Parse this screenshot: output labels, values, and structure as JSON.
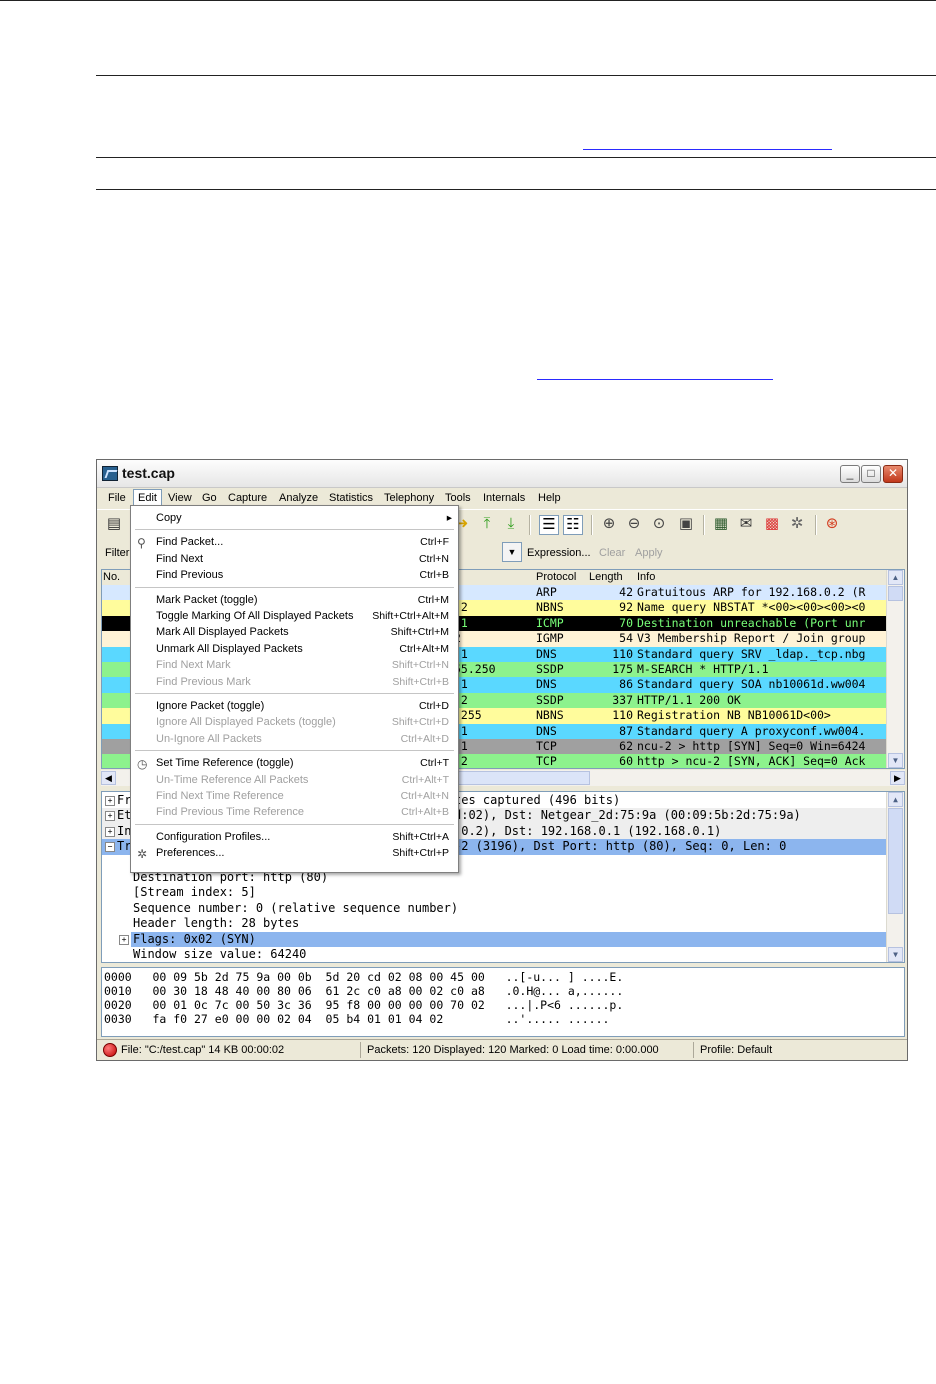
{
  "window": {
    "title": "test.cap",
    "controls": {
      "minimize": "_",
      "maximize": "□",
      "close": "✕"
    }
  },
  "menubar": [
    "File",
    "Edit",
    "View",
    "Go",
    "Capture",
    "Analyze",
    "Statistics",
    "Telephony",
    "Tools",
    "Internals",
    "Help"
  ],
  "filterbar": {
    "label": "Filter",
    "expression": "Expression...",
    "clear": "Clear",
    "apply": "Apply"
  },
  "packet_list": {
    "columns": [
      "No.",
      "Protocol",
      "Length",
      "Info"
    ],
    "rows": [
      {
        "tail": "",
        "protocol": "ARP",
        "length": "42",
        "info": "Gratuitous ARP for 192.168.0.2 (R",
        "bg": "#d6e8ff",
        "fg": "#000000"
      },
      {
        "tail": ".2",
        "protocol": "NBNS",
        "length": "92",
        "info": "Name query NBSTAT *<00><00><00><0",
        "bg": "#fffc9c",
        "fg": "#000000"
      },
      {
        "tail": ".1",
        "protocol": "ICMP",
        "length": "70",
        "info": "Destination unreachable (Port unr",
        "bg": "#000000",
        "fg": "#78ff78"
      },
      {
        "tail": "2",
        "protocol": "IGMP",
        "length": "54",
        "info": "V3 Membership Report / Join group",
        "bg": "#fff3d6",
        "fg": "#000000"
      },
      {
        "tail": ".1",
        "protocol": "DNS",
        "length": "110",
        "info": "Standard query SRV _ldap._tcp.nbg",
        "bg": "#5ad8ff",
        "fg": "#000000"
      },
      {
        "tail": "55.250",
        "protocol": "SSDP",
        "length": "175",
        "info": "M-SEARCH * HTTP/1.1",
        "bg": "#8df28d",
        "fg": "#000000"
      },
      {
        "tail": ".1",
        "protocol": "DNS",
        "length": "86",
        "info": "Standard query SOA nb10061d.ww004",
        "bg": "#5ad8ff",
        "fg": "#000000"
      },
      {
        "tail": ".2",
        "protocol": "SSDP",
        "length": "337",
        "info": "HTTP/1.1 200 OK",
        "bg": "#8df28d",
        "fg": "#000000"
      },
      {
        "tail": ".255",
        "protocol": "NBNS",
        "length": "110",
        "info": "Registration NB NB10061D<00>",
        "bg": "#fffc9c",
        "fg": "#000000"
      },
      {
        "tail": ".1",
        "protocol": "DNS",
        "length": "87",
        "info": "Standard query A proxyconf.ww004.",
        "bg": "#5ad8ff",
        "fg": "#000000"
      },
      {
        "tail": ".1",
        "protocol": "TCP",
        "length": "62",
        "info": "ncu-2 > http [SYN] Seq=0 Win=6424",
        "bg": "#a0a0a0",
        "fg": "#000000"
      },
      {
        "tail": ".2",
        "protocol": "TCP",
        "length": "60",
        "info": "http > ncu-2 [SYN, ACK] Seq=0 Ack",
        "bg": "#8df28d",
        "fg": "#000000"
      }
    ]
  },
  "details": {
    "rows": [
      {
        "prefix": "Fr",
        "text": "tes captured (496 bits)",
        "expander": "+",
        "selected": false,
        "bg": "#ffffff"
      },
      {
        "prefix": "Et",
        "text": "d:02), Dst: Netgear_2d:75:9a (00:09:5b:2d:75:9a)",
        "expander": "+",
        "selected": false,
        "bg": "#eeeeee"
      },
      {
        "prefix": "In",
        "text": ".0.2), Dst: 192.168.0.1 (192.168.0.1)",
        "expander": "+",
        "selected": false,
        "bg": "#eeeeee"
      },
      {
        "prefix": "Tr",
        "text": "-2 (3196), Dst Port: http (80), Seq: 0, Len: 0",
        "expander": "−",
        "selected": true,
        "bg": "#8cb5ee"
      }
    ],
    "fields": [
      "Destination port: http (80)",
      "[Stream index: 5]",
      "Sequence number: 0    (relative sequence number)",
      "Header length: 28 bytes",
      "Flags: 0x02 (SYN)",
      "Window size value: 64240"
    ]
  },
  "bytes": [
    "0000   00 09 5b 2d 75 9a 00 0b  5d 20 cd 02 08 00 45 00   ..[-u... ] ....E.",
    "0010   00 30 18 48 40 00 80 06  61 2c c0 a8 00 02 c0 a8   .0.H@... a,......",
    "0020   00 01 0c 7c 00 50 3c 36  95 f8 00 00 00 00 70 02   ...|.P<6 ......p.",
    "0030   fa f0 27 e0 00 00 02 04  05 b4 01 01 04 02         ..'..... ......"
  ],
  "status": {
    "file": "File: \"C:/test.cap\" 14 KB 00:00:02",
    "packets": "Packets: 120 Displayed: 120 Marked: 0 Load time: 0:00.000",
    "profile": "Profile: Default"
  },
  "edit_menu": [
    {
      "label": "Copy",
      "shortcut": "",
      "disabled": false,
      "submenu": true
    },
    {
      "sep": true
    },
    {
      "label": "Find Packet...",
      "shortcut": "Ctrl+F",
      "disabled": false,
      "icon": "find"
    },
    {
      "label": "Find Next",
      "shortcut": "Ctrl+N",
      "disabled": false
    },
    {
      "label": "Find Previous",
      "shortcut": "Ctrl+B",
      "disabled": false
    },
    {
      "sep": true
    },
    {
      "label": "Mark Packet (toggle)",
      "shortcut": "Ctrl+M",
      "disabled": false
    },
    {
      "label": "Toggle Marking Of All Displayed Packets",
      "shortcut": "Shift+Ctrl+Alt+M",
      "disabled": false
    },
    {
      "label": "Mark All Displayed Packets",
      "shortcut": "Shift+Ctrl+M",
      "disabled": false
    },
    {
      "label": "Unmark All Displayed Packets",
      "shortcut": "Ctrl+Alt+M",
      "disabled": false
    },
    {
      "label": "Find Next Mark",
      "shortcut": "Shift+Ctrl+N",
      "disabled": true
    },
    {
      "label": "Find Previous Mark",
      "shortcut": "Shift+Ctrl+B",
      "disabled": true
    },
    {
      "sep": true
    },
    {
      "label": "Ignore Packet (toggle)",
      "shortcut": "Ctrl+D",
      "disabled": false
    },
    {
      "label": "Ignore All Displayed Packets (toggle)",
      "shortcut": "Shift+Ctrl+D",
      "disabled": true
    },
    {
      "label": "Un-Ignore All Packets",
      "shortcut": "Ctrl+Alt+D",
      "disabled": true
    },
    {
      "sep": true
    },
    {
      "label": "Set Time Reference (toggle)",
      "shortcut": "Ctrl+T",
      "disabled": false,
      "icon": "clock"
    },
    {
      "label": "Un-Time Reference All Packets",
      "shortcut": "Ctrl+Alt+T",
      "disabled": true
    },
    {
      "label": "Find Next Time Reference",
      "shortcut": "Ctrl+Alt+N",
      "disabled": true
    },
    {
      "label": "Find Previous Time Reference",
      "shortcut": "Ctrl+Alt+B",
      "disabled": true
    },
    {
      "sep": true
    },
    {
      "label": "Configuration Profiles...",
      "shortcut": "Shift+Ctrl+A",
      "disabled": false
    },
    {
      "label": "Preferences...",
      "shortcut": "Shift+Ctrl+P",
      "disabled": false,
      "icon": "tools"
    }
  ]
}
